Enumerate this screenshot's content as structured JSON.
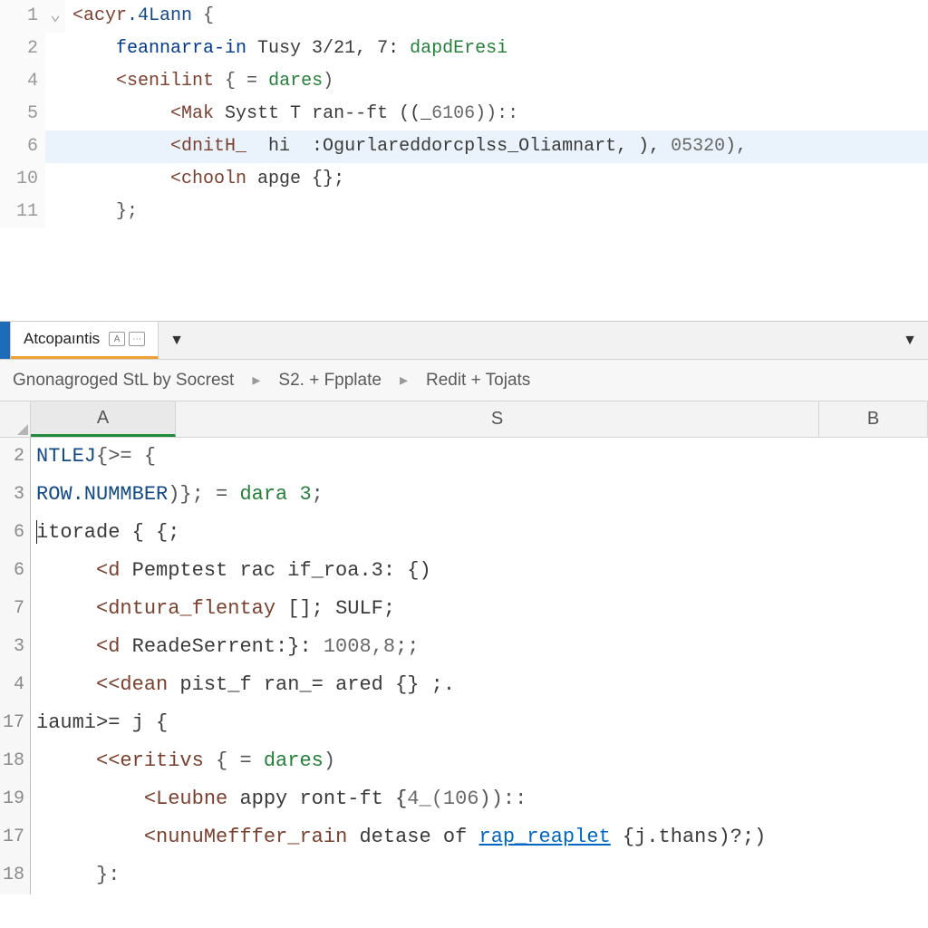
{
  "top": {
    "lines": [
      {
        "num": "1",
        "fold": "⌄"
      },
      {
        "num": "2",
        "fold": ""
      },
      {
        "num": "4",
        "fold": ""
      },
      {
        "num": "5",
        "fold": ""
      },
      {
        "num": "6",
        "fold": ""
      },
      {
        "num": "10",
        "fold": ""
      },
      {
        "num": "11",
        "fold": ""
      }
    ],
    "l1": {
      "a": "<acyr",
      "b": ".4Lann",
      "c": " {"
    },
    "l2": {
      "a": "feannarra-in",
      "b": " Tusy 3/21, 7: ",
      "c": "dapdEresi"
    },
    "l3": {
      "a": "<senilint",
      "b": " { = ",
      "c": "dares",
      "d": ")"
    },
    "l4": {
      "a": "<Mak",
      "b": " Systt T ran--ft ((_",
      "c": "6106",
      "d": "))::"
    },
    "l5": {
      "a": "<dnitH_",
      "b": "  hi  :Ogurlareddorcplss_Oliamnart, ), ",
      "c": "05320",
      "d": "),"
    },
    "l6": {
      "a": "<chooln",
      "b": " apge {};"
    },
    "l7": {
      "a": "};"
    }
  },
  "midbar": {
    "tab": "Atcopaıntis",
    "icon1": "A",
    "icon2": "⋯"
  },
  "crumbs": {
    "a": "Gnonagroged StL by Socrest",
    "b": "S2. + Fpplate",
    "c": "Redit + Tojats"
  },
  "cols": {
    "a": "A",
    "s": "S",
    "b": "B"
  },
  "bottom": {
    "nums": [
      "2",
      "3",
      "6",
      "6",
      "7",
      "3",
      "4",
      "17",
      "18",
      "19",
      "17",
      "18"
    ],
    "r2": {
      "a": "NTLEJ",
      "b": "{>= {"
    },
    "r3": {
      "a": "ROW.NUMMBER",
      "b": ")}; = ",
      "c": "dara 3",
      "d": ";"
    },
    "r4": {
      "a": "itorade { {;"
    },
    "r5": {
      "a": "<d",
      "b": " Pemptest rac if_roa.3: {)"
    },
    "r6": {
      "a": "<dntura_flentay",
      "b": " []; SULF;"
    },
    "r7": {
      "a": "<d",
      "b": " ReadeSerrent:}: ",
      "c": "1008,8",
      "d": ";;"
    },
    "r8": {
      "a": "<<dean",
      "b": " pist_f ran_= ared {} ;."
    },
    "r9": {
      "a": "iaumi>= j {"
    },
    "r10": {
      "a": "<<eritivs",
      "b": " { = ",
      "c": "dares",
      "d": ")"
    },
    "r11": {
      "a": "<Leubne",
      "b": " appy ront-ft {",
      "c": "4_(106",
      "d": "))::"
    },
    "r12": {
      "a": "<nunuMefffer_rain",
      "b": " detase of ",
      "c": "rap_reaplet",
      "d": " {j.thans)?;)"
    },
    "r13": {
      "a": "}:"
    }
  }
}
